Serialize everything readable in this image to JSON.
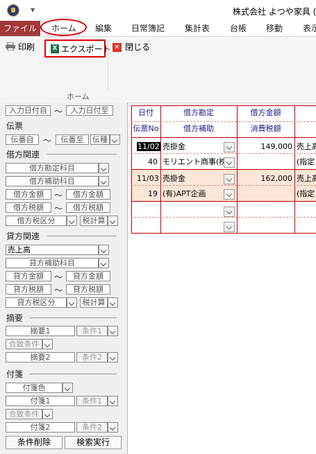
{
  "window": {
    "title": "株式会社 よつや家具 (ﾆ"
  },
  "menu": {
    "file": "ファイル",
    "tabs": [
      "ホーム",
      "編集",
      "日常簿記",
      "集計表",
      "台帳",
      "移動",
      "表示"
    ]
  },
  "ribbon": {
    "print": "印刷",
    "export": "エクスポート",
    "close": "閉じる",
    "group": "ホーム",
    "excel_glyph": "X"
  },
  "filters": {
    "input_date_from": "入力日付自",
    "input_date_to": "入力日付至",
    "tilde": "〜",
    "voucher": {
      "section": "伝票",
      "no_from": "伝番自",
      "no_to": "伝番至",
      "kind": "伝種"
    },
    "debit": {
      "section": "借方関連",
      "account": "借方勘定科目",
      "sub_account": "借方補助科目",
      "amount_from": "借方金額",
      "amount_to": "借方金額",
      "tax_from": "借方税額",
      "tax_to": "借方税額",
      "tax_class": "借方税区分",
      "tax_calc": "税計算"
    },
    "credit": {
      "section": "貸方関連",
      "account_value": "売上高",
      "sub_account": "貸方補助科目",
      "amount_from": "貸方金額",
      "amount_to": "貸方金額",
      "tax_from": "貸方税額",
      "tax_to": "貸方税額",
      "tax_class": "貸方税区分",
      "tax_calc": "税計算"
    },
    "summary": {
      "section": "摘要",
      "summary1": "摘要1",
      "cond1": "条件1",
      "combine": "合致条件",
      "summary2": "摘要2",
      "cond2": "条件2"
    },
    "sticky": {
      "section": "付箋",
      "color": "付箋色",
      "note1": "付箋1",
      "cond1": "条件1",
      "combine": "合致条件",
      "note2": "付箋2",
      "cond2": "条件2"
    },
    "clear_button": "条件削除",
    "search_button": "検索実行"
  },
  "grid": {
    "headers_top": [
      "日付",
      "借方勘定",
      "借方金額"
    ],
    "headers_bottom": [
      "伝票No",
      "借方補助",
      "消費税額"
    ],
    "rows": [
      {
        "date": "11/02",
        "account": "売掛金",
        "amount": "149,000",
        "voucher": "40",
        "sub": "モリエント商事(株",
        "credit": "売上高",
        "credit_sub": "(指定"
      },
      {
        "date": "11/03",
        "account": "売掛金",
        "amount": "162,000",
        "voucher": "19",
        "sub": "(有)APT企画",
        "credit": "売上高",
        "credit_sub": "(指定"
      }
    ]
  },
  "colors": {
    "file_menu": "#a4373a",
    "highlight": "#e00000",
    "selected_row": "#fbe6d8",
    "grid_lines": "#c00000"
  }
}
